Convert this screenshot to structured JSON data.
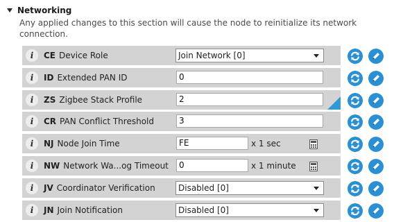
{
  "section": {
    "title": "Networking",
    "description": "Any applied changes to this section will cause the node to reinitialize its network connection."
  },
  "colors": {
    "accent": "#2b8fd4",
    "panel": "#d3d3d3"
  },
  "rows": [
    {
      "code": "CE",
      "name": "Device Role",
      "control": "select",
      "value": "Join Network [0]"
    },
    {
      "code": "ID",
      "name": "Extended PAN ID",
      "control": "text",
      "value": "0"
    },
    {
      "code": "ZS",
      "name": "Zigbee Stack Profile",
      "control": "text",
      "value": "2",
      "modified": true
    },
    {
      "code": "CR",
      "name": "PAN Conflict Threshold",
      "control": "text",
      "value": "3"
    },
    {
      "code": "NJ",
      "name": "Node Join Time",
      "control": "text-unit",
      "value": "FE",
      "unit": "x 1 sec"
    },
    {
      "code": "NW",
      "name": "Network Wa...og Timeout",
      "control": "text-unit",
      "value": "0",
      "unit": "x 1 minute"
    },
    {
      "code": "JV",
      "name": "Coordinator Verification",
      "control": "select",
      "value": "Disabled [0]"
    },
    {
      "code": "JN",
      "name": "Join Notification",
      "control": "select",
      "value": "Disabled [0]"
    }
  ],
  "icons": {
    "info": "info-icon",
    "refresh": "refresh-icon",
    "write": "pencil-icon",
    "calculator": "calculator-icon",
    "expand": "triangle-down-icon"
  }
}
